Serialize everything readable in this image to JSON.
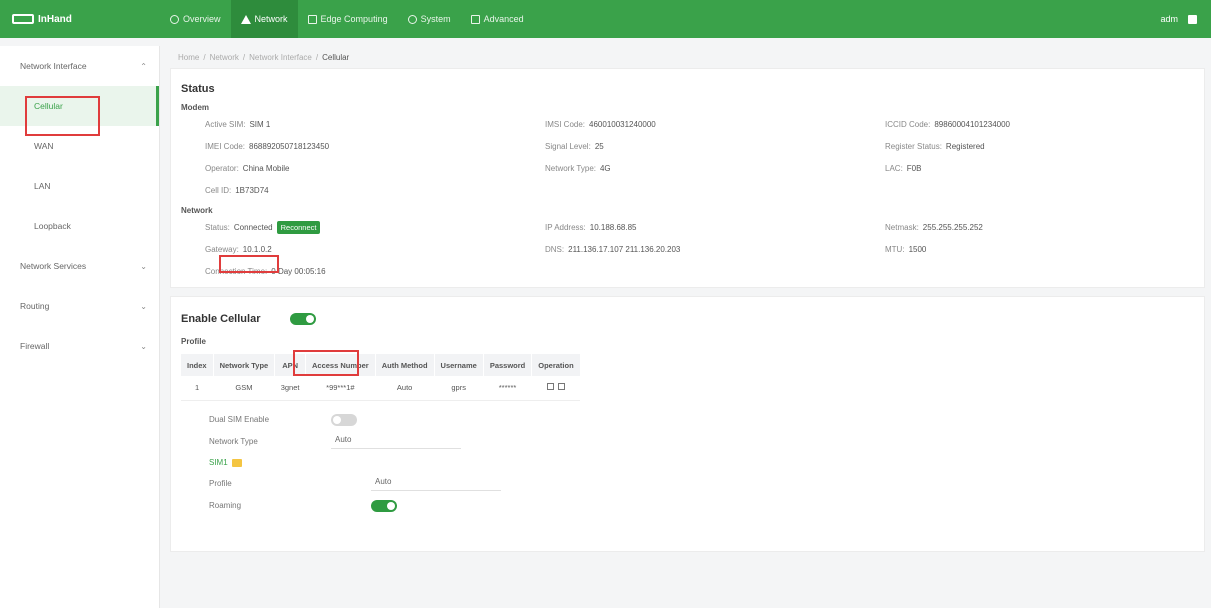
{
  "brand": {
    "name": "InHand"
  },
  "nav": {
    "items": [
      {
        "label": "Overview",
        "icon": "overview-icon"
      },
      {
        "label": "Network",
        "icon": "network-icon"
      },
      {
        "label": "Edge Computing",
        "icon": "edge-icon"
      },
      {
        "label": "System",
        "icon": "system-icon"
      },
      {
        "label": "Advanced",
        "icon": "advanced-icon"
      }
    ],
    "user": "adm"
  },
  "sidebar": {
    "groups": [
      {
        "label": "Network Interface"
      },
      {
        "label": "Network Services"
      },
      {
        "label": "Routing"
      },
      {
        "label": "Firewall"
      }
    ],
    "subitems": [
      "Cellular",
      "WAN",
      "LAN",
      "Loopback"
    ]
  },
  "breadcrumb": [
    "Home",
    "Network",
    "Network Interface",
    "Cellular"
  ],
  "status": {
    "title": "Status",
    "modem_label": "Modem",
    "modem": [
      [
        "Active SIM:",
        "SIM 1"
      ],
      [
        "IMSI Code:",
        "460010031240000"
      ],
      [
        "ICCID Code:",
        "89860004101234000"
      ],
      [
        "IMEI Code:",
        "868892050718123450"
      ],
      [
        "Signal Level:",
        "25"
      ],
      [
        "Register Status:",
        "Registered"
      ],
      [
        "Operator:",
        "China Mobile"
      ],
      [
        "Network Type:",
        "4G"
      ],
      [
        "LAC:",
        "F0B"
      ],
      [
        "Cell ID:",
        "1B73D74"
      ],
      [
        "",
        ""
      ],
      [
        "",
        ""
      ]
    ],
    "network_label": "Network",
    "net_status_label": "Status:",
    "net_status_value": "Connected",
    "net_status_badge": "Reconnect",
    "network": [
      [
        "IP Address:",
        "10.188.68.85"
      ],
      [
        "Netmask:",
        "255.255.255.252"
      ],
      [
        "Gateway:",
        "10.1.0.2"
      ],
      [
        "DNS:",
        "211.136.17.107 211.136.20.203"
      ],
      [
        "MTU:",
        "1500"
      ],
      [
        "Connection Time:",
        "0 Day 00:05:16"
      ],
      [
        "",
        ""
      ],
      [
        "",
        ""
      ]
    ]
  },
  "cellular": {
    "title": "Enable Cellular",
    "profile_label": "Profile",
    "table": {
      "headers": [
        "Index",
        "Network Type",
        "APN",
        "Access Number",
        "Auth Method",
        "Username",
        "Password",
        "Operation"
      ],
      "rows": [
        [
          "1",
          "GSM",
          "3gnet",
          "*99***1#",
          "Auto",
          "gprs",
          "******",
          ""
        ]
      ]
    },
    "dual_sim_label": "Dual SIM Enable",
    "network_type_label": "Network Type",
    "network_type_value": "Auto",
    "sim1_label": "SIM1",
    "profile_row_label": "Profile",
    "profile_row_value": "Auto",
    "roaming_label": "Roaming"
  }
}
